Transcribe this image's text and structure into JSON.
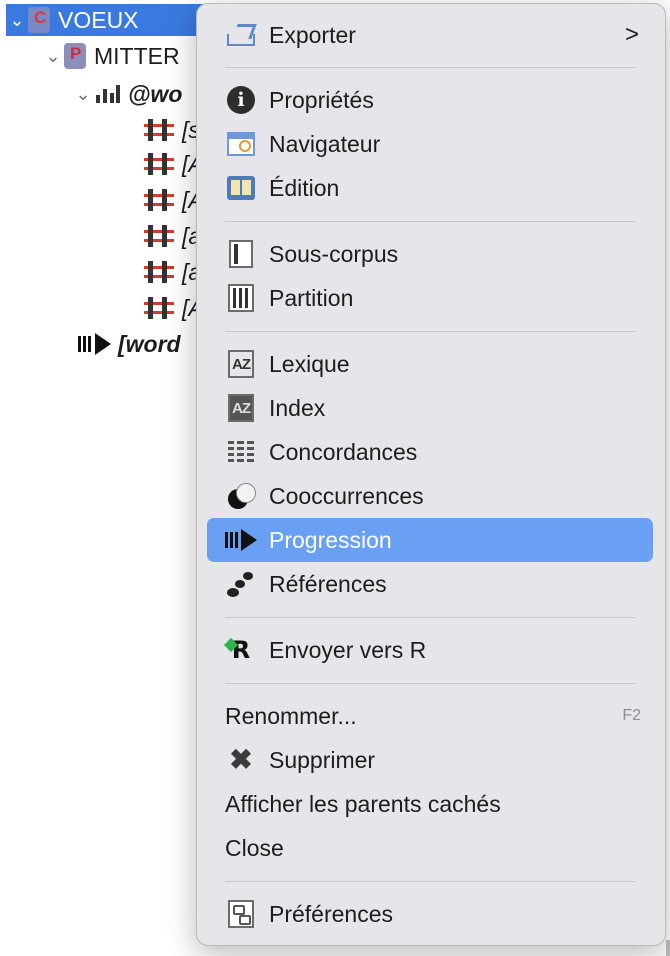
{
  "tree": {
    "root": {
      "label": "VOEUX"
    },
    "partition": {
      "label": "MITTER"
    },
    "structure": {
      "label": "@wo"
    },
    "subcorpora": [
      "[s",
      "[A",
      "[A",
      "[a",
      "[a",
      "[A"
    ],
    "progression": {
      "label": "[word"
    }
  },
  "menu": {
    "export": {
      "label": "Exporter",
      "icon": "export-icon",
      "submenu_indicator": ">"
    },
    "properties": {
      "label": "Propriétés",
      "icon": "info-icon"
    },
    "navigator": {
      "label": "Navigateur",
      "icon": "navigator-icon"
    },
    "edition": {
      "label": "Édition",
      "icon": "book-icon"
    },
    "subcorpus": {
      "label": "Sous-corpus",
      "icon": "subcorpus-icon"
    },
    "partition": {
      "label": "Partition",
      "icon": "partition-icon"
    },
    "lexicon": {
      "label": "Lexique",
      "icon": "az-icon"
    },
    "index": {
      "label": "Index",
      "icon": "az-inverse-icon"
    },
    "concordances": {
      "label": "Concordances",
      "icon": "concordance-icon"
    },
    "cooccurrences": {
      "label": "Cooccurrences",
      "icon": "cooccurrence-icon"
    },
    "progression": {
      "label": "Progression",
      "icon": "progression-icon",
      "highlighted": true
    },
    "references": {
      "label": "Références",
      "icon": "references-icon"
    },
    "send_r": {
      "label": "Envoyer vers R",
      "icon": "r-icon"
    },
    "rename": {
      "label": "Renommer...",
      "shortcut": "F2"
    },
    "delete": {
      "label": "Supprimer",
      "icon": "delete-icon"
    },
    "show_hidden_parents": {
      "label": "Afficher les parents cachés"
    },
    "close": {
      "label": "Close"
    },
    "preferences": {
      "label": "Préférences",
      "icon": "preferences-icon"
    }
  },
  "colors": {
    "selection": "#3a7ae0",
    "menu_highlight": "#6aa0f3",
    "menu_background": "#e6e6ea"
  }
}
